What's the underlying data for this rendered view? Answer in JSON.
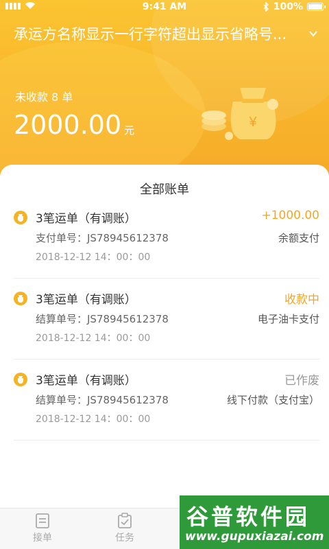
{
  "statusbar": {
    "time": "9:41 AM",
    "battery": "100%"
  },
  "header": {
    "carrier_name": "承运方名称显示一行字符超出显示省略号...",
    "unpaid_label": "未收款 8 单",
    "amount": "2000.00",
    "amount_unit": "元"
  },
  "card": {
    "title": "全部账单"
  },
  "bills": [
    {
      "name": "3笔运单（有调账）",
      "status": "+1000.00",
      "status_color": "#f5a623",
      "no": "支付单号：JS78945612378",
      "method": "余额支付",
      "time": "2018-12-12  14：00：00"
    },
    {
      "name": "3笔运单（有调账）",
      "status": "收款中",
      "status_color": "#f5a623",
      "no": "结算单号：JS78945612378",
      "method": "电子油卡支付",
      "time": "2018-12-12  14：00：00"
    },
    {
      "name": "3笔运单（有调账）",
      "status": "已作废",
      "status_color": "#999999",
      "no": "结算单号：JS78945612378",
      "method": "线下付款（支付宝）",
      "time": "2018-12-12  14：00：00"
    }
  ],
  "tabs": [
    {
      "label": "接单",
      "icon": "list-icon"
    },
    {
      "label": "任务",
      "icon": "clipboard-icon"
    }
  ],
  "watermark": {
    "top": "谷普软件园",
    "bottom": "www.gupuxiazai.com"
  },
  "colors": {
    "accent": "#f8b42b",
    "coin": "#f5b324"
  }
}
